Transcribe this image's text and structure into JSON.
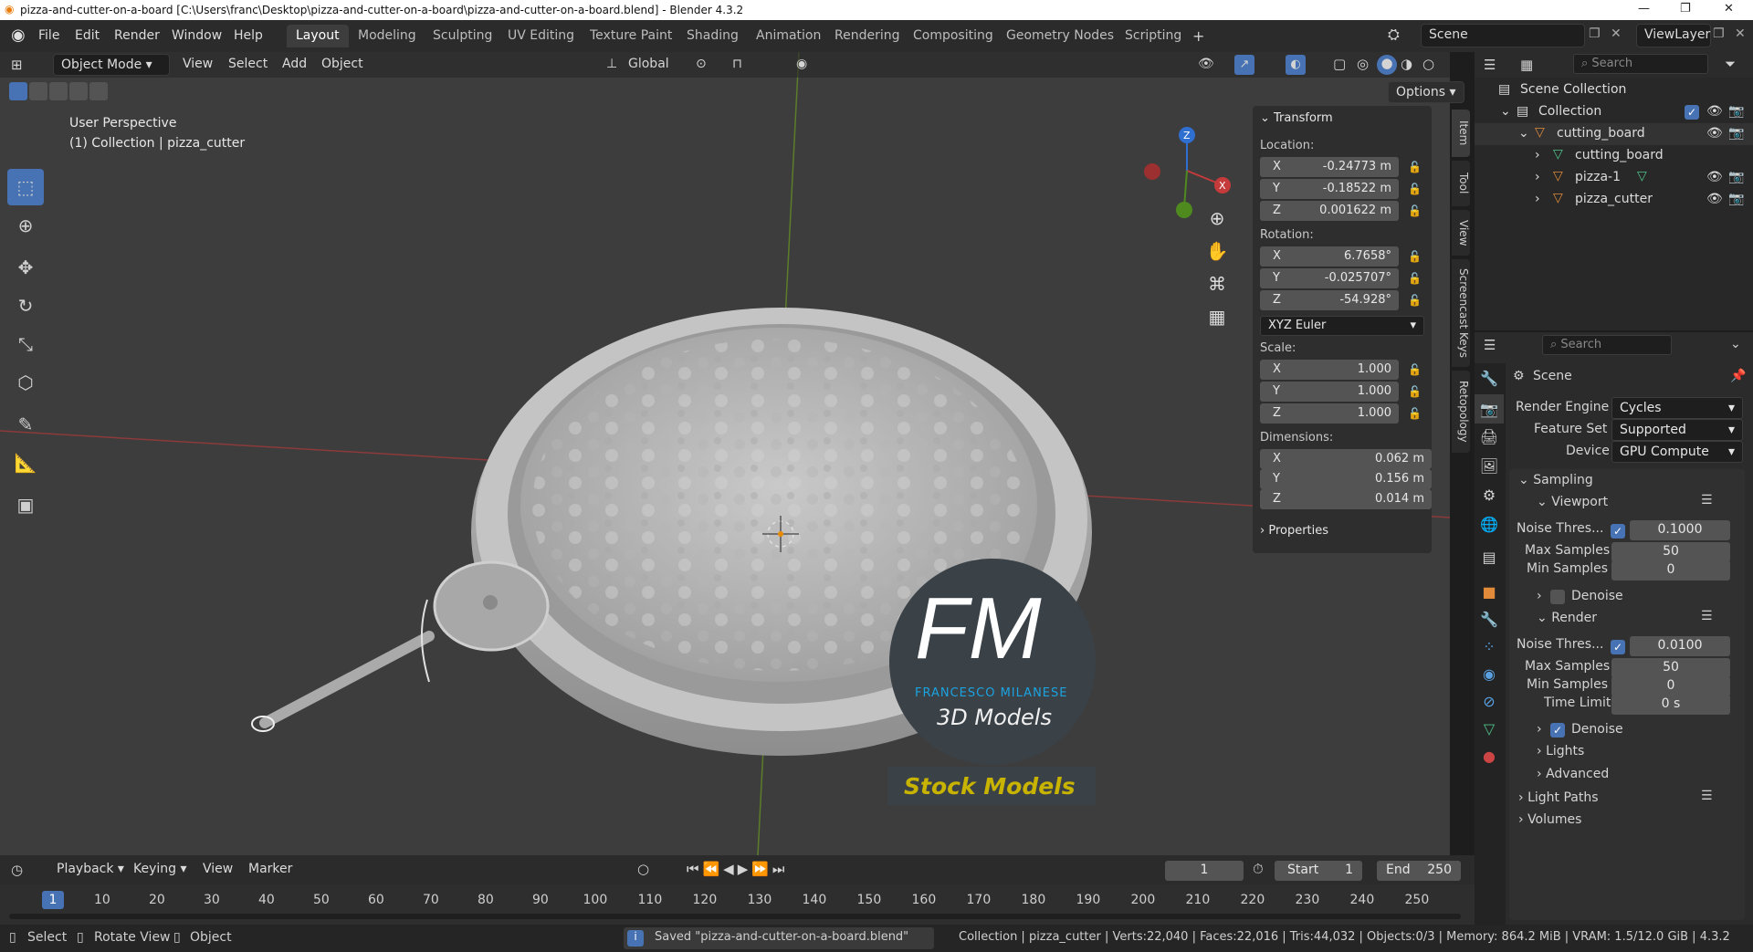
{
  "window": {
    "title": "pizza-and-cutter-on-a-board [C:\\Users\\franc\\Desktop\\pizza-and-cutter-on-a-board\\pizza-and-cutter-on-a-board.blend] - Blender 4.3.2",
    "controls": [
      "—",
      "❐",
      "✕"
    ]
  },
  "menus": [
    "File",
    "Edit",
    "Render",
    "Window",
    "Help"
  ],
  "workspaces": [
    "Layout",
    "Modeling",
    "Sculpting",
    "UV Editing",
    "Texture Paint",
    "Shading",
    "Animation",
    "Rendering",
    "Compositing",
    "Geometry Nodes",
    "Scripting"
  ],
  "active_workspace": "Layout",
  "scene_name": "Scene",
  "view_layer": "ViewLayer",
  "viewport_header": {
    "mode": "Object Mode",
    "menus": [
      "View",
      "Select",
      "Add",
      "Object"
    ],
    "orientation": "Global",
    "options": "Options"
  },
  "viewport": {
    "perspective": "User Perspective",
    "collection_info": "(1) Collection | pizza_cutter",
    "watermark_title": "FM",
    "watermark_name": "FRANCESCO MILANESE",
    "watermark_sub": "3D Models",
    "watermark_banner": "Stock Models"
  },
  "transform": {
    "header": "Transform",
    "location_label": "Location:",
    "location": [
      [
        "X",
        "-0.24773 m"
      ],
      [
        "Y",
        "-0.18522 m"
      ],
      [
        "Z",
        "0.001622 m"
      ]
    ],
    "rotation_label": "Rotation:",
    "rotation": [
      [
        "X",
        "6.7658°"
      ],
      [
        "Y",
        "-0.025707°"
      ],
      [
        "Z",
        "-54.928°"
      ]
    ],
    "rotation_mode": "XYZ Euler",
    "scale_label": "Scale:",
    "scale": [
      [
        "X",
        "1.000"
      ],
      [
        "Y",
        "1.000"
      ],
      [
        "Z",
        "1.000"
      ]
    ],
    "dimensions_label": "Dimensions:",
    "dimensions": [
      [
        "X",
        "0.062 m"
      ],
      [
        "Y",
        "0.156 m"
      ],
      [
        "Z",
        "0.014 m"
      ]
    ],
    "properties_header": "Properties"
  },
  "side_tabs": [
    "Item",
    "Tool",
    "View",
    "Screencast Keys",
    "Retopology"
  ],
  "outliner": {
    "search_placeholder": "Search",
    "rows": [
      {
        "label": "Scene Collection",
        "indent": 0
      },
      {
        "label": "Collection",
        "indent": 1
      },
      {
        "label": "cutting_board",
        "indent": 2
      },
      {
        "label": "cutting_board",
        "indent": 3
      },
      {
        "label": "pizza-1",
        "indent": 3
      },
      {
        "label": "pizza_cutter",
        "indent": 3
      }
    ]
  },
  "properties": {
    "search_placeholder": "Search",
    "context": "Scene",
    "render_engine_label": "Render Engine",
    "render_engine": "Cycles",
    "feature_set_label": "Feature Set",
    "feature_set": "Supported",
    "device_label": "Device",
    "device": "GPU Compute",
    "sampling": "Sampling",
    "viewport": "Viewport",
    "noise_label": "Noise Thres...",
    "vp_noise": "0.1000",
    "max_samples_label": "Max Samples",
    "vp_max": "50",
    "min_samples_label": "Min Samples",
    "vp_min": "0",
    "denoise": "Denoise",
    "render": "Render",
    "r_noise": "0.0100",
    "r_max": "50",
    "r_min": "0",
    "time_limit_label": "Time Limit",
    "time_limit": "0 s",
    "lights": "Lights",
    "advanced": "Advanced",
    "light_paths": "Light Paths",
    "volumes": "Volumes"
  },
  "timeline": {
    "menus": [
      "Playback",
      "Keying",
      "View",
      "Marker"
    ],
    "current_frame": "1",
    "start_label": "Start",
    "start": "1",
    "end_label": "End",
    "end": "250",
    "ticks": [
      "1",
      "10",
      "20",
      "30",
      "40",
      "50",
      "60",
      "70",
      "80",
      "90",
      "100",
      "110",
      "120",
      "130",
      "140",
      "150",
      "160",
      "170",
      "180",
      "190",
      "200",
      "210",
      "220",
      "230",
      "240",
      "250"
    ]
  },
  "statusbar": {
    "select": "Select",
    "rotate": "Rotate View",
    "object": "Object",
    "message": "Saved \"pizza-and-cutter-on-a-board.blend\"",
    "stats": "Collection | pizza_cutter | Verts:22,040 | Faces:22,016 | Tris:44,032 | Objects:0/3 | Memory: 864.2 MiB | VRAM: 1.5/12.0 GiB | 4.3.2"
  },
  "colors": {
    "accent": "#4772b3",
    "watermark_blue": "#1ba3e0",
    "banner_yellow": "#c8b400"
  }
}
